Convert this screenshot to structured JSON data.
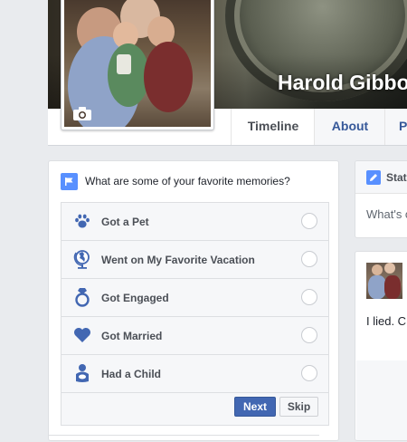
{
  "profile": {
    "name": "Harold Gibbons"
  },
  "nav": {
    "tabs": [
      {
        "label": "Timeline",
        "active": true
      },
      {
        "label": "About",
        "active": false
      },
      {
        "label": "P",
        "active": false
      }
    ]
  },
  "memories": {
    "question": "What are some of your favorite memories?",
    "options": [
      {
        "label": "Got a Pet",
        "icon": "paw-icon"
      },
      {
        "label": "Went on My Favorite Vacation",
        "icon": "globe-icon"
      },
      {
        "label": "Got Engaged",
        "icon": "ring-icon"
      },
      {
        "label": "Got Married",
        "icon": "heart-icon"
      },
      {
        "label": "Had a Child",
        "icon": "baby-icon"
      }
    ],
    "next_label": "Next",
    "skip_label": "Skip"
  },
  "status": {
    "tab_label": "Stat",
    "placeholder": "What's c"
  },
  "post": {
    "text": "I lied. C some w"
  },
  "colors": {
    "accent": "#4267b2",
    "link": "#365899",
    "icon_blue": "#5890ff",
    "page_bg": "#e9ebee"
  }
}
